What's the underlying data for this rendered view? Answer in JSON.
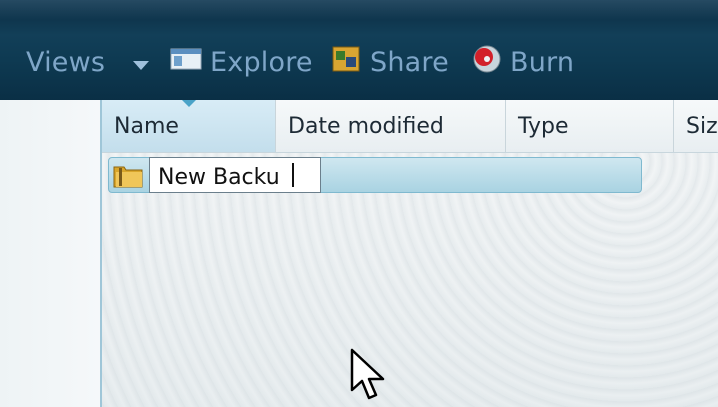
{
  "toolbar": {
    "views_label": "Views",
    "explore_label": "Explore",
    "share_label": "Share",
    "burn_label": "Burn"
  },
  "columns": [
    {
      "label": "Name"
    },
    {
      "label": "Date modified"
    },
    {
      "label": "Type"
    },
    {
      "label": "Siz"
    }
  ],
  "rows": [
    {
      "name_edit_value": "New Backu",
      "icon": "folder-icon"
    }
  ],
  "colors": {
    "toolbar_bg": "#0e3a52",
    "toolbar_text": "#7fa6c8",
    "selection": "#a9d3e2"
  }
}
